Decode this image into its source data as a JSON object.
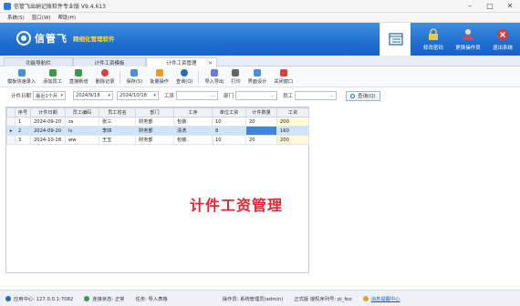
{
  "window": {
    "title": "信管飞出纳记账软件专业版 V9.4.613"
  },
  "menu": [
    "系统(S)",
    "窗口(W)",
    "帮助(H)"
  ],
  "banner": {
    "brand": "信管飞",
    "slogan": "精细化管理软件"
  },
  "top_buttons": [
    {
      "label": "修改密码",
      "icon": "lock-icon"
    },
    {
      "label": "更换操作员",
      "icon": "user-icon"
    },
    {
      "label": "退出系统",
      "icon": "close-icon"
    }
  ],
  "tabs": [
    "功能导航栏",
    "计件工资模板",
    "计件工资管理"
  ],
  "toolbar": [
    {
      "label": "模板快速录入",
      "icon": "template-icon",
      "color": "#4a8fd8"
    },
    {
      "label": "添加员工",
      "icon": "add-user-icon",
      "color": "#3c9a4a"
    },
    {
      "label": "直接新增",
      "icon": "add-icon",
      "color": "#3c9a4a"
    },
    {
      "label": "删除记录",
      "icon": "delete-icon",
      "color": "#d94040"
    },
    {
      "label": "保存(S)",
      "icon": "save-icon",
      "color": "#4a8fd8"
    },
    {
      "label": "批量操作",
      "icon": "batch-icon",
      "color": "#e0a030"
    },
    {
      "label": "查询(Q)",
      "icon": "search-icon",
      "color": "#2b6cb0"
    },
    {
      "label": "导入导出",
      "icon": "import-export-icon",
      "color": "#6a7ad8"
    },
    {
      "label": "打印",
      "icon": "print-icon",
      "color": "#666666"
    },
    {
      "label": "界面设计",
      "icon": "design-icon",
      "color": "#4a8fd8"
    },
    {
      "label": "关闭窗口",
      "icon": "close-window-icon",
      "color": "#d94040"
    }
  ],
  "filter": {
    "date_label": "计件日期",
    "range": "最近1个月",
    "from": "2024/9/18",
    "to": "2024/10/18",
    "process_label": "工序",
    "dept_label": "部门",
    "employee_label": "员工",
    "query": "查询(Q)"
  },
  "table": {
    "headers": [
      "序号",
      "计件日期",
      "员工编码",
      "员工姓名",
      "部门",
      "工序",
      "单位工资",
      "计件数量",
      "工资"
    ],
    "rows": [
      [
        "1",
        "2024-09-20",
        "zs",
        "张三",
        "财务部",
        "包装",
        "10",
        "20",
        "200"
      ],
      [
        "2",
        "2024-09-20",
        "ls",
        "李四",
        "财务部",
        "清洗",
        "8",
        "",
        "160"
      ],
      [
        "3",
        "2024-10-18",
        "ww",
        "王五",
        "财务部",
        "包装",
        "10",
        "20",
        "200"
      ]
    ]
  },
  "watermark": "计件工资管理",
  "status": {
    "server": "应用中心: 127.0.0.1:7082",
    "connection": "连接状态: 正常",
    "task": "任务: 导入表格",
    "operator": "操作员: 系统管理员(admin)",
    "edition": "正式版  授权序列号: pl_fee",
    "message": "消息提醒中心"
  }
}
